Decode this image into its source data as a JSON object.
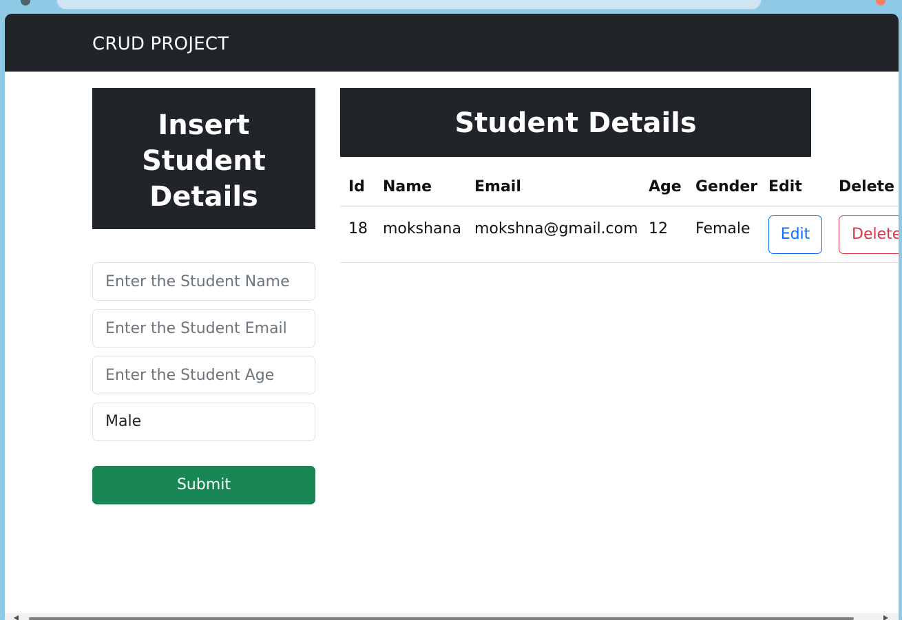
{
  "navbar": {
    "brand": "CRUD PROJECT"
  },
  "insert_panel": {
    "title_lines": [
      "Insert",
      "Student",
      "Details"
    ]
  },
  "form": {
    "name_placeholder": "Enter the Student Name",
    "email_placeholder": "Enter the Student Email",
    "age_placeholder": "Enter the Student Age",
    "gender_selected": "Male",
    "submit_label": "Submit"
  },
  "details_panel": {
    "title": "Student Details"
  },
  "table": {
    "columns": [
      "Id",
      "Name",
      "Email",
      "Age",
      "Gender",
      "Edit",
      "Delete"
    ],
    "rows": [
      {
        "id": "18",
        "name": "mokshana",
        "email": "mokshna@gmail.com",
        "age": "12",
        "gender": "Female",
        "edit_label": "Edit",
        "delete_label": "Delete"
      }
    ]
  },
  "colors": {
    "dark": "#212529",
    "success": "#198754",
    "primary": "#0d6efd",
    "danger": "#dc3545",
    "page_bg": "#8ecae6"
  }
}
